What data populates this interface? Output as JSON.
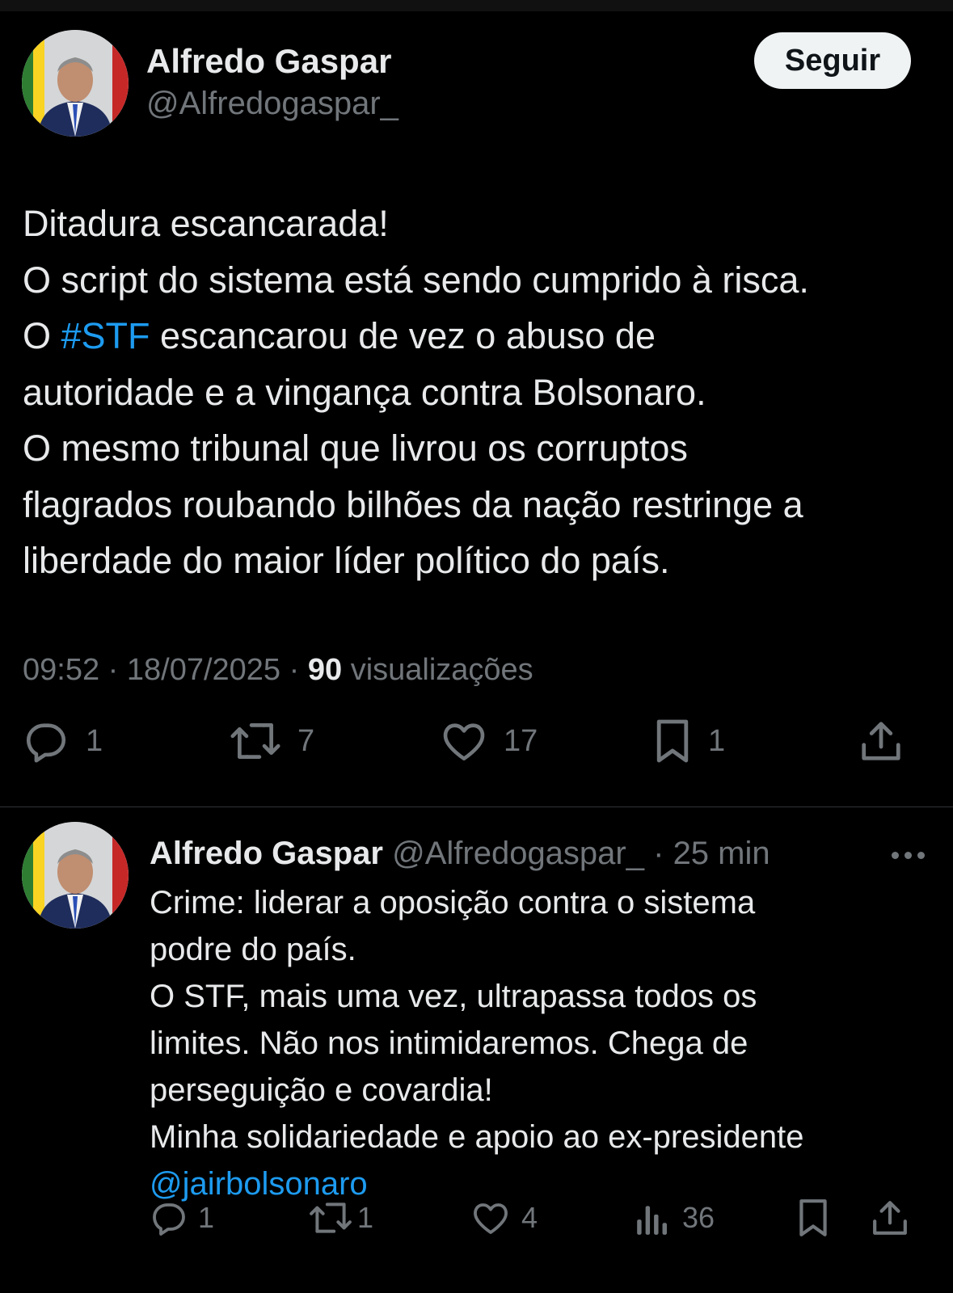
{
  "main_tweet": {
    "author_name": "Alfredo Gaspar",
    "author_handle": "@Alfredogaspar_",
    "follow_label": "Seguir",
    "lines": [
      "Ditadura escancarada!",
      "O script do sistema está sendo cumprido à risca.",
      "O ",
      "#STF",
      " escancarou de vez o abuso de",
      "autoridade e a vingança contra Bolsonaro.",
      "O mesmo tribunal que livrou os corruptos",
      "flagrados roubando bilhões da nação restringe a",
      "liberdade do maior líder político do país."
    ],
    "time": "09:52",
    "date": "18/07/2025",
    "views_count": "90",
    "views_label": "visualizações",
    "replies": "1",
    "reposts": "7",
    "likes": "17",
    "bookmarks": "1"
  },
  "reply_tweet": {
    "author_name": "Alfredo Gaspar",
    "author_handle": "@Alfredogaspar_",
    "time_ago": "25 min",
    "lines": [
      "Crime: liderar a oposição contra o sistema",
      "podre do país.",
      "O STF, mais uma vez, ultrapassa todos os",
      "limites. Não nos intimidaremos. Chega de",
      "perseguição e covardia!",
      "Minha solidariedade e apoio ao ex-presidente",
      "@jairbolsonaro"
    ],
    "replies": "1",
    "reposts": "1",
    "likes": "4",
    "views": "36"
  },
  "colors": {
    "background": "#000000",
    "text": "#e7e9ea",
    "muted": "#71767b",
    "link": "#1d9bf0",
    "follow_bg": "#eff3f4"
  },
  "icons": [
    "reply-icon",
    "repost-icon",
    "like-icon",
    "bookmark-icon",
    "share-icon",
    "views-icon",
    "more-icon"
  ]
}
